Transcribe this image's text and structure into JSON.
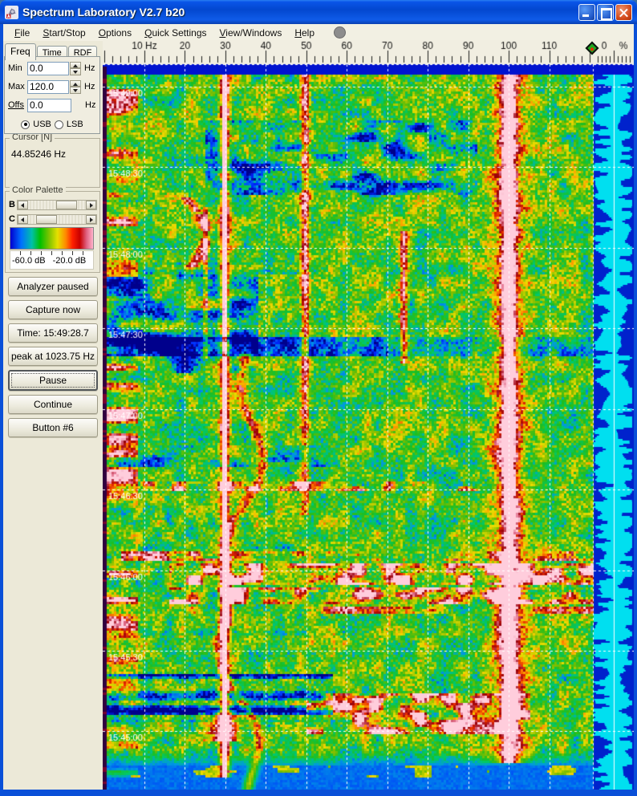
{
  "window": {
    "title": "Spectrum Laboratory V2.7 b20"
  },
  "menubar": {
    "items": [
      "File",
      "Start/Stop",
      "Options",
      "Quick Settings",
      "View/Windows",
      "Help"
    ]
  },
  "panel": {
    "tabs": [
      "Freq",
      "Time",
      "RDF"
    ],
    "min_label": "Min",
    "min_value": "0.0",
    "min_unit": "Hz",
    "max_label": "Max",
    "max_value": "120.0",
    "max_unit": "Hz",
    "offs_label": "Offs",
    "offs_value": "0.0",
    "offs_unit": "Hz",
    "usb_label": "USB",
    "lsb_label": "LSB",
    "cursor_group": {
      "title": "Cursor [N]",
      "value": "44.85246 Hz"
    },
    "palette_group": {
      "title": "Color Palette",
      "b_label": "B",
      "c_label": "C",
      "scale_left": "-60.0 dB",
      "scale_right": "-20.0 dB"
    },
    "buttons": {
      "analyzer": "Analyzer paused",
      "capture": "Capture now",
      "time": "Time: 15:49:28.7",
      "peak": "peak at 1023.75 Hz",
      "pause": "Pause",
      "continue": "Continue",
      "button6": "Button #6"
    }
  },
  "waterfall": {
    "freq_axis": {
      "unit": "Hz",
      "min_hz": 0,
      "max_hz": 120,
      "minor_tick_hz": 2,
      "major_tick_hz": 10
    },
    "freq_tick_labels": [
      "10 Hz",
      "20",
      "30",
      "40",
      "50",
      "60",
      "70",
      "80",
      "90",
      "100",
      "110"
    ],
    "right_scale": {
      "zero": "0",
      "percent": "%"
    },
    "time_labels": [
      "15:49:00",
      "15:48:30",
      "15:48:00",
      "15:47:30",
      "15:47:00",
      "15:46:30",
      "15:46:00",
      "15:45:30",
      "15:45:00"
    ],
    "seconds_per_gridline": 30,
    "signals": [
      {
        "freq_hz": 25,
        "note": "intermittent carrier, upper-mid section"
      },
      {
        "freq_hz": 30,
        "note": "strong persistent carrier, pink core, full height"
      },
      {
        "freq_hz": 50,
        "note": "carrier visible in upper half"
      },
      {
        "freq_hz": 74,
        "note": "short carrier segment"
      },
      {
        "freq_hz": 100,
        "note": "strong wide carrier band, pink/dark-red core, full height"
      }
    ],
    "colors": {
      "palette": [
        "#00008c",
        "#0028ff",
        "#0096e6",
        "#00c86e",
        "#1ebe1e",
        "#82be00",
        "#ebdc00",
        "#ff9600",
        "#e62800",
        "#96000a",
        "#e16e8c",
        "#ffcddc"
      ],
      "grid": "#ffffff",
      "pane_background": "#00dff0",
      "pane_spikes": "#0022cc",
      "top_band": "#0013cf"
    }
  }
}
